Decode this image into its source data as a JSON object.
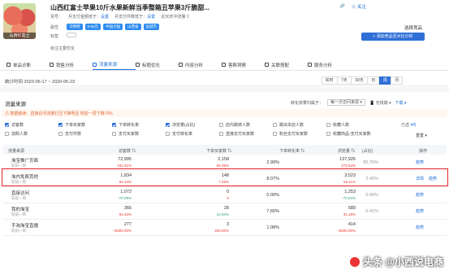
{
  "product": {
    "thumb_label": "山西红富士",
    "title": "山西红富士苹果10斤水果新鲜当季整箱丑苹果3斤脆甜...",
    "follow": "关注",
    "meta": {
      "seller_label": "货号：",
      "price_label": "月支付金额低于：",
      "price_link": "设置",
      "conv_label": "月支付件数低于：",
      "conv_link": "设置",
      "days": "近30天中流量 2"
    },
    "attr_label": "属性",
    "attrs": [
      "汉物特",
      "8-50元",
      "中国大陆",
      "山西省",
      "运城市"
    ],
    "tag_label": "标签",
    "select_link": "选择竞品",
    "analyze_button": "+ 添加竞品至对比分析",
    "note": "标注主要优化"
  },
  "tabs": [
    {
      "label": "单品诊断",
      "active": false
    },
    {
      "label": "销售分析",
      "active": false
    },
    {
      "label": "流量来源",
      "active": true
    },
    {
      "label": "标题优化",
      "active": false
    },
    {
      "label": "内容分析",
      "active": false
    },
    {
      "label": "客群洞察",
      "active": false
    },
    {
      "label": "关联搭配",
      "active": false
    },
    {
      "label": "服务分析",
      "active": false
    }
  ],
  "date": {
    "text": "统计时间 2020-05-17 ~ 2020-05-23",
    "buttons": [
      {
        "label": "实时",
        "on": false
      },
      {
        "label": "7天",
        "on": false
      },
      {
        "label": "30天",
        "on": false
      },
      {
        "label": "日",
        "on": false
      },
      {
        "label": "周",
        "on": true
      },
      {
        "label": "月",
        "on": false
      }
    ]
  },
  "section": {
    "title": "流量来源",
    "effect_label": "转化效果归属于：",
    "effect_value": "每一次访问来源",
    "unlimited": "无线端",
    "download": "下载"
  },
  "tip": "数据解读：直接访问流量打压下降明显 较前一周下降70%",
  "checkboxes": [
    [
      {
        "label": "访客数",
        "on": true
      },
      {
        "label": "下单买家数",
        "on": true
      },
      {
        "label": "下单转化率",
        "on": true
      },
      {
        "label": "浏览量(占比)",
        "on": true
      },
      {
        "label": "店内跳转人数",
        "on": false
      },
      {
        "label": "跳出本店人数",
        "on": false
      },
      {
        "label": "收藏人数",
        "on": false
      }
    ],
    [
      {
        "label": "加购人数",
        "on": false
      },
      {
        "label": "支付件数",
        "on": false
      },
      {
        "label": "支付买家数",
        "on": false
      },
      {
        "label": "支付转化率",
        "on": false
      },
      {
        "label": "直接支付买家数",
        "on": false
      },
      {
        "label": "粉丝支付买家数",
        "on": false
      },
      {
        "label": "收藏商品-支付买家数",
        "on": false
      }
    ]
  ],
  "selected_info": {
    "prefix": "已选",
    "count": "4/5",
    "reset": "重置"
  },
  "table": {
    "headers": [
      "流量来源",
      "访客数",
      "下单买家数",
      "下单转化率",
      "浏览量",
      "(占比)",
      "操作"
    ],
    "rows": [
      {
        "name": "淘宝推广页面",
        "sub": "较前一周",
        "visitors": "72,995",
        "visitors_d": "184.31%",
        "buyers": "2,158",
        "buyers_d": "58.35%",
        "conv": "2.99%",
        "pv": "137,926",
        "pv_d": "272.54%",
        "share": "85.75%",
        "ops": [
          "趋势"
        ],
        "d_color": "red"
      },
      {
        "name": "淘内免费其他",
        "sub": "较前一周",
        "visitors": "1,834",
        "visitors_d": "84.34%",
        "buyers": "148",
        "buyers_d": "7.25%",
        "conv": "8.07%",
        "pv": "3,523",
        "pv_d": "54.11%",
        "share": "2.45%",
        "ops": [
          "详情",
          "趋势"
        ],
        "d_color": "red"
      },
      {
        "name": "直接访问",
        "sub": "较前一周",
        "visitors": "1,072",
        "visitors_d": "-70.09%",
        "buyers": "0",
        "buyers_d": "0",
        "conv": "0.00%",
        "pv": "1,253",
        "pv_d": "-70.04%",
        "share": "0.66%",
        "ops": [
          "趋势"
        ],
        "d_color": "red"
      },
      {
        "name": "我的淘宝",
        "sub": "较前一周",
        "visitors": "366",
        "visitors_d": "54.43%",
        "buyers": "28",
        "buyers_d": "-12.50%",
        "conv": "7.65%",
        "pv": "589",
        "pv_d": "31.18%",
        "share": "0.41%",
        "ops": [
          "趋势"
        ],
        "d_color": "red"
      },
      {
        "name": "手淘淘宝直播",
        "sub": "较前一周",
        "visitors": "277",
        "visitors_d": "+5000.00%",
        "buyers": "3",
        "buyers_d": "200.00%",
        "conv": "1.08%",
        "pv": "414",
        "pv_d": "+5000.00%",
        "share": "",
        "ops": [
          "趋势"
        ],
        "d_color": "red"
      }
    ]
  },
  "watermark": "头条 @小西说电商",
  "colors": {
    "accent": "#2f6fd8",
    "highlight": "#e0252a",
    "red": "#e33333"
  }
}
